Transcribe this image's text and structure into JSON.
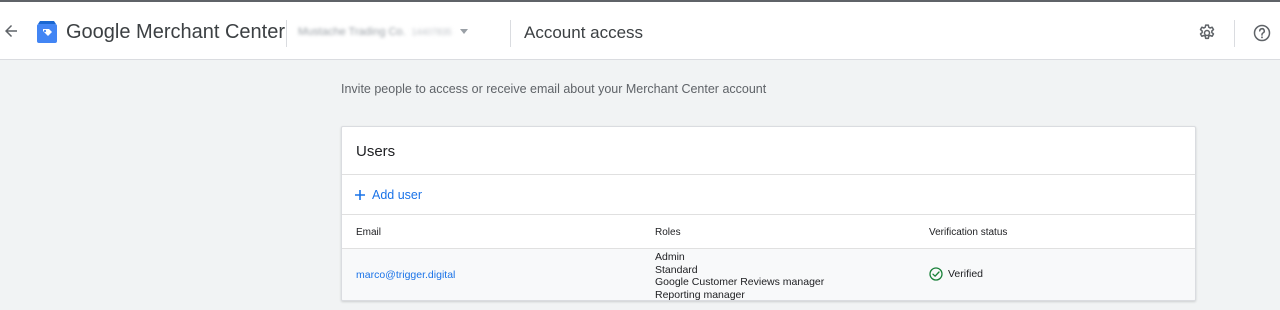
{
  "header": {
    "product_name": "Google Merchant Center",
    "account_name": "Mustache Trading Co.",
    "account_id": "14407835",
    "page_title": "Account access",
    "icons": [
      "back-arrow-icon",
      "merchant-center-logo",
      "chevron-down-icon",
      "gear-icon",
      "help-icon"
    ]
  },
  "subtitle": "Invite people to access or receive email about your Merchant Center account",
  "users_card": {
    "title": "Users",
    "add_user_label": "Add user",
    "columns": [
      "Email",
      "Roles",
      "Verification status"
    ],
    "rows": [
      {
        "email": "marco@trigger.digital",
        "roles": [
          "Admin",
          "Standard",
          "Google Customer Reviews manager",
          "Reporting manager"
        ],
        "status": "Verified"
      }
    ]
  },
  "colors": {
    "accent": "#1a73e8",
    "verified": "#188038",
    "logo_blue": "#4285f4"
  }
}
